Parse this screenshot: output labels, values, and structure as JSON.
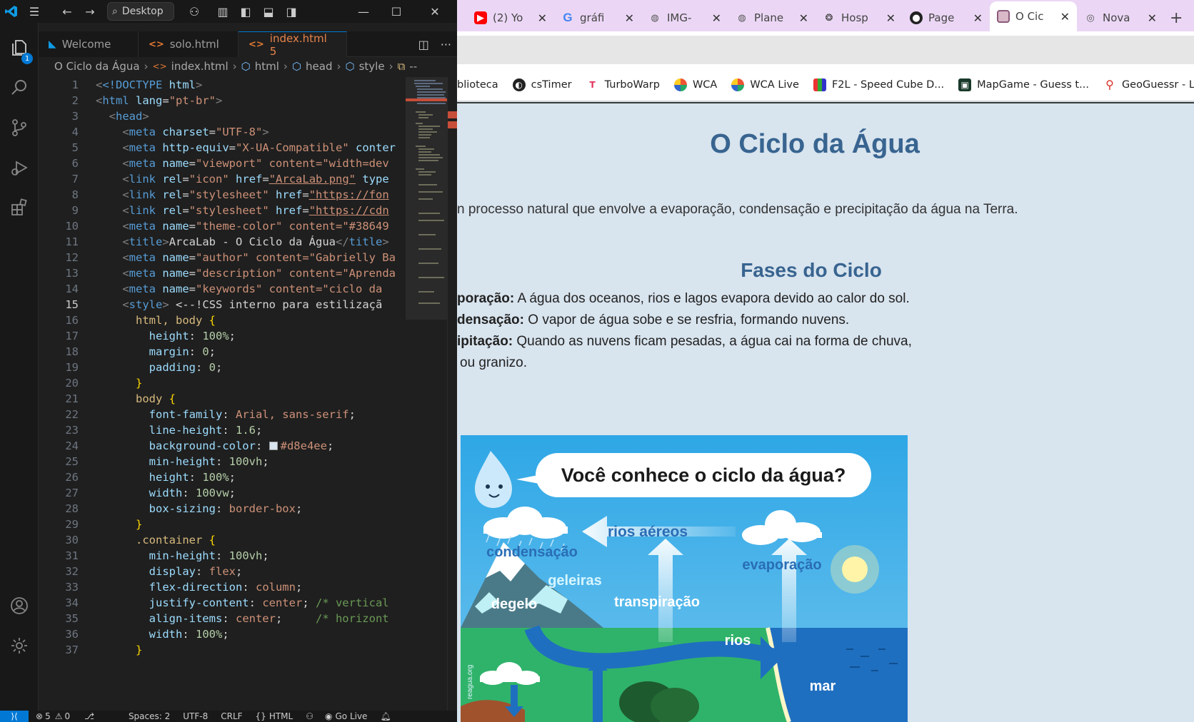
{
  "vscode": {
    "search_label": "Desktop",
    "tabs": [
      {
        "label": "Welcome"
      },
      {
        "label": "solo.html"
      },
      {
        "label": "index.html 5"
      }
    ],
    "breadcrumb": [
      "O Ciclo da Água",
      "index.html",
      "html",
      "head",
      "style",
      "--"
    ],
    "explorer_badge": "1",
    "lines": [
      {
        "n": "1"
      },
      {
        "n": "2"
      },
      {
        "n": "3"
      },
      {
        "n": "4"
      },
      {
        "n": "5"
      },
      {
        "n": "6"
      },
      {
        "n": "7"
      },
      {
        "n": "8"
      },
      {
        "n": "9"
      },
      {
        "n": "10"
      },
      {
        "n": "11"
      },
      {
        "n": "12"
      },
      {
        "n": "13"
      },
      {
        "n": "14"
      },
      {
        "n": "15"
      },
      {
        "n": "16"
      },
      {
        "n": "17"
      },
      {
        "n": "18"
      },
      {
        "n": "19"
      },
      {
        "n": "20"
      },
      {
        "n": "21"
      },
      {
        "n": "22"
      },
      {
        "n": "23"
      },
      {
        "n": "24"
      },
      {
        "n": "25"
      },
      {
        "n": "26"
      },
      {
        "n": "27"
      },
      {
        "n": "28"
      },
      {
        "n": "29"
      },
      {
        "n": "30"
      },
      {
        "n": "31"
      },
      {
        "n": "32"
      },
      {
        "n": "33"
      },
      {
        "n": "34"
      },
      {
        "n": "35"
      },
      {
        "n": "36"
      },
      {
        "n": "37"
      }
    ],
    "code": {
      "l1a": "<!DOCTYPE",
      "l1b": " html",
      "l1c": ">",
      "l2_lang": "\"pt-br\"",
      "l4_charset": "\"UTF-8\"",
      "l5_equiv": "\"X-UA-Compatible\"",
      "l5_rest": " conter",
      "l6_name": "\"viewport\"",
      "l6_rest": " content=\"width=dev",
      "l7_href": "\"ArcaLab.png\"",
      "l7_rest": " type",
      "l8_href": "\"https://fon",
      "l9_href": "\"https://cdn",
      "l10_name": "\"theme-color\"",
      "l10_rest": " content=\"#38649",
      "l11_title": "ArcaLab - O Ciclo da Água",
      "l12_name": "\"author\"",
      "l12_rest": " content=\"Gabrielly Ba",
      "l13_name": "\"description\"",
      "l13_rest": " content=\"Aprenda",
      "l14_name": "\"keywords\"",
      "l14_rest": " content=\"ciclo da",
      "l15_comment": "<--!CSS interno para estilizaçã",
      "l16_sel": "html, body",
      "l17_val": "100%",
      "l18_val": "0",
      "l19_val": "0",
      "l22_val": "Arial, sans-serif",
      "l23_val": "1.6",
      "l24_val": "#d8e4ee",
      "l25_val": "100vh",
      "l26_val": "100%",
      "l27_val": "100vw",
      "l28_val": "border-box",
      "l30_sel": ".container",
      "l31_val": "100vh",
      "l32_val": "flex",
      "l33_val": "column",
      "l34_val": "center",
      "l34_com": "/* vertical",
      "l35_val": "center",
      "l35_com": "/* horizont",
      "l36_val": "100%"
    },
    "status": {
      "errors": "5",
      "warnings": "0",
      "spaces": "Spaces: 2",
      "encoding": "UTF-8",
      "eol": "CRLF",
      "language": "HTML",
      "golive": "Go Live"
    }
  },
  "browser": {
    "tabs": [
      {
        "title": "(2) Yo"
      },
      {
        "title": "gráfi"
      },
      {
        "title": "IMG-"
      },
      {
        "title": "Plane"
      },
      {
        "title": "Hosp"
      },
      {
        "title": "Page"
      },
      {
        "title": "O Cic"
      },
      {
        "title": "Nova"
      }
    ],
    "bookmarks": [
      {
        "label": "blioteca"
      },
      {
        "label": "csTimer"
      },
      {
        "label": "TurboWarp"
      },
      {
        "label": "WCA"
      },
      {
        "label": "WCA Live"
      },
      {
        "label": "F2L - Speed Cube D..."
      },
      {
        "label": "MapGame - Guess t..."
      },
      {
        "label": "GeoGuessr - Let's e..."
      }
    ],
    "page": {
      "title": "O Ciclo da Água",
      "intro": "n processo natural que envolve a evaporação, condensação e precipitação da água na Terra.",
      "phases_title": "Fases do Ciclo",
      "phases": [
        {
          "term": "poração:",
          "text": " A água dos oceanos, rios e lagos evapora devido ao calor do sol."
        },
        {
          "term": "densação:",
          "text": " O vapor de água sobe e se resfria, formando nuvens."
        },
        {
          "term": "ipitação:",
          "text": " Quando as nuvens ficam pesadas, a água cai na forma de chuva,"
        },
        {
          "term": "",
          "text": "ou granizo."
        }
      ],
      "image": {
        "question": "Você conhece o ciclo da água?",
        "labels": {
          "rios_aereos": "rios aéreos",
          "condensacao": "condensação",
          "geleiras": "geleiras",
          "evaporacao": "evaporação",
          "degelo": "degelo",
          "transpiracao": "transpiração",
          "rios": "rios",
          "mar": "mar",
          "watermark": "reagua.org"
        }
      }
    }
  }
}
